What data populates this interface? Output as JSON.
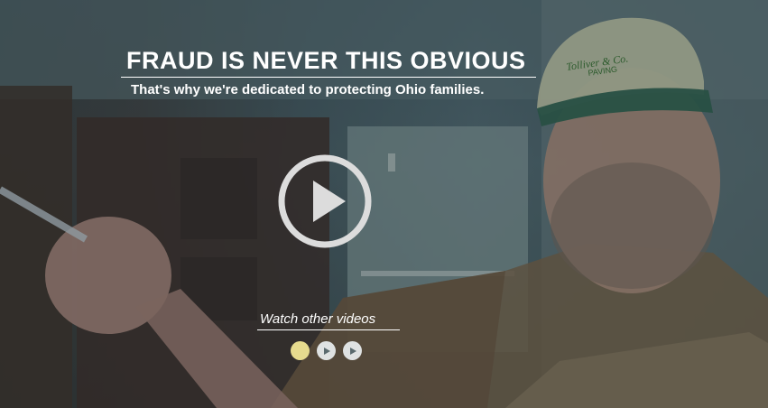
{
  "hero": {
    "headline": "FRAUD IS NEVER THIS OBVIOUS",
    "tagline": "That's why we're dedicated to protecting Ohio families.",
    "cap_text_line1": "Tolliver & Co.",
    "cap_text_line2": "PAVING",
    "watch_label": "Watch other videos",
    "dots": [
      {
        "state": "active"
      },
      {
        "state": "video"
      },
      {
        "state": "video"
      }
    ],
    "colors": {
      "active_dot": "#e6db8e",
      "inactive_dot": "#dfe2e2",
      "overlay": "#3c5a64"
    }
  }
}
